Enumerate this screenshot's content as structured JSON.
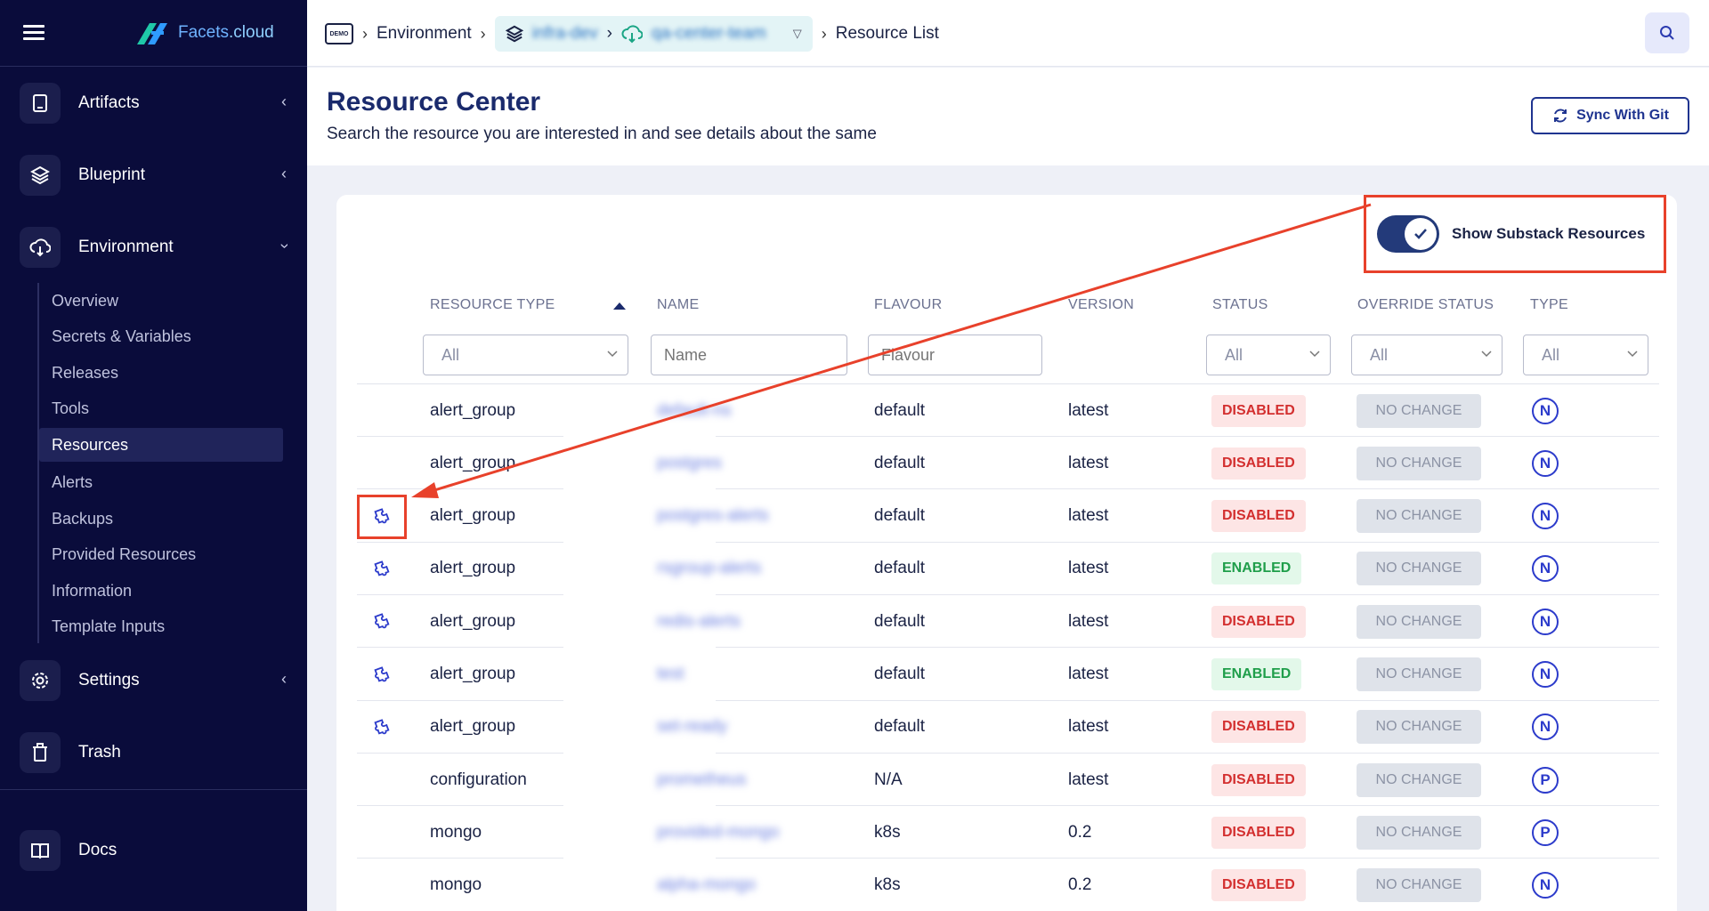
{
  "brand": {
    "name": "Facets",
    "suffix": ".cloud"
  },
  "sidebar": {
    "items": [
      {
        "label": "Artifacts",
        "icon": "tablet-icon"
      },
      {
        "label": "Blueprint",
        "icon": "layers-icon"
      },
      {
        "label": "Environment",
        "icon": "cloud-download-icon"
      },
      {
        "label": "Settings",
        "icon": "gear-icon"
      },
      {
        "label": "Trash",
        "icon": "trash-icon"
      },
      {
        "label": "Docs",
        "icon": "book-icon"
      }
    ],
    "sub_items": [
      "Overview",
      "Secrets & Variables",
      "Releases",
      "Tools",
      "Resources",
      "Alerts",
      "Backups",
      "Provided Resources",
      "Information",
      "Template Inputs"
    ],
    "active_sub": "Resources"
  },
  "breadcrumb": {
    "demo_badge": "DEMO",
    "environment": "Environment",
    "stack": "infra-dev",
    "env_name": "qa-center-team",
    "current": "Resource List"
  },
  "header": {
    "title": "Resource Center",
    "subtitle": "Search the resource you are interested in and see details about the same",
    "sync_label": "Sync With Git"
  },
  "toggle": {
    "label": "Show Substack Resources",
    "on": true
  },
  "table": {
    "headers": [
      "RESOURCE TYPE",
      "NAME",
      "FLAVOUR",
      "VERSION",
      "STATUS",
      "OVERRIDE STATUS",
      "TYPE"
    ],
    "filters": {
      "resource_type": "All",
      "name_placeholder": "Name",
      "flavour_placeholder": "Flavour",
      "status": "All",
      "override_status": "All",
      "type": "All"
    },
    "rows": [
      {
        "substack": false,
        "resource_type": "alert_group",
        "name": "default-ns",
        "flavour": "default",
        "version": "latest",
        "status": "DISABLED",
        "override": "NO CHANGE",
        "type": "N"
      },
      {
        "substack": false,
        "resource_type": "alert_group",
        "name": "postgres",
        "flavour": "default",
        "version": "latest",
        "status": "DISABLED",
        "override": "NO CHANGE",
        "type": "N"
      },
      {
        "substack": true,
        "resource_type": "alert_group",
        "name": "postgres-alerts",
        "flavour": "default",
        "version": "latest",
        "status": "DISABLED",
        "override": "NO CHANGE",
        "type": "N"
      },
      {
        "substack": true,
        "resource_type": "alert_group",
        "name": "rsgroup-alerts",
        "flavour": "default",
        "version": "latest",
        "status": "ENABLED",
        "override": "NO CHANGE",
        "type": "N"
      },
      {
        "substack": true,
        "resource_type": "alert_group",
        "name": "redis-alerts",
        "flavour": "default",
        "version": "latest",
        "status": "DISABLED",
        "override": "NO CHANGE",
        "type": "N"
      },
      {
        "substack": true,
        "resource_type": "alert_group",
        "name": "test",
        "flavour": "default",
        "version": "latest",
        "status": "ENABLED",
        "override": "NO CHANGE",
        "type": "N"
      },
      {
        "substack": true,
        "resource_type": "alert_group",
        "name": "set-ready",
        "flavour": "default",
        "version": "latest",
        "status": "DISABLED",
        "override": "NO CHANGE",
        "type": "N"
      },
      {
        "substack": false,
        "resource_type": "configuration",
        "name": "prometheus",
        "flavour": "N/A",
        "version": "latest",
        "status": "DISABLED",
        "override": "NO CHANGE",
        "type": "P"
      },
      {
        "substack": false,
        "resource_type": "mongo",
        "name": "provided-mongo",
        "flavour": "k8s",
        "version": "0.2",
        "status": "DISABLED",
        "override": "NO CHANGE",
        "type": "P"
      },
      {
        "substack": false,
        "resource_type": "mongo",
        "name": "alpha-mongo",
        "flavour": "k8s",
        "version": "0.2",
        "status": "DISABLED",
        "override": "NO CHANGE",
        "type": "N"
      }
    ]
  },
  "colors": {
    "accent": "#1f3490",
    "annotation": "#e8412b",
    "sidebar_bg": "#0a0c3b"
  }
}
